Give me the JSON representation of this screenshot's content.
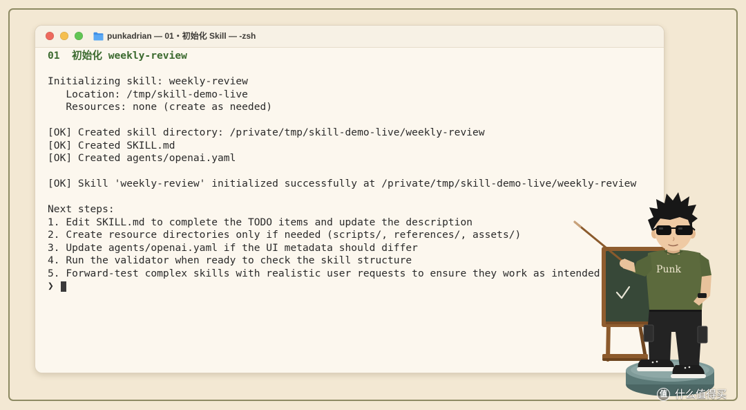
{
  "window": {
    "title": "punkadrian — 01・初始化 Skill — -zsh",
    "title_icon": "folder-icon",
    "traffic_lights": {
      "close": "#ed6a5e",
      "minimize": "#f5bf4f",
      "zoom": "#61c554"
    }
  },
  "terminal": {
    "heading": "01  初始化 weekly-review",
    "init": {
      "line": "Initializing skill: weekly-review",
      "location": "Location: /tmp/skill-demo-live",
      "resources": "Resources: none (create as needed)"
    },
    "created": [
      "[OK] Created skill directory: /private/tmp/skill-demo-live/weekly-review",
      "[OK] Created SKILL.md",
      "[OK] Created agents/openai.yaml"
    ],
    "success": "[OK] Skill 'weekly-review' initialized successfully at /private/tmp/skill-demo-live/weekly-review",
    "next_steps": {
      "title": "Next steps:",
      "items": [
        "1. Edit SKILL.md to complete the TODO items and update the description",
        "2. Create resource directories only if needed (scripts/, references/, assets/)",
        "3. Update agents/openai.yaml if the UI metadata should differ",
        "4. Run the validator when ready to check the skill structure",
        "5. Forward-test complex skills with realistic user requests to ensure they work as intended"
      ]
    },
    "prompt": "❯"
  },
  "illustration": {
    "shirt_text": "Punk",
    "board_icon": "checkmark-icon"
  },
  "watermark": {
    "logo_glyph": "值",
    "text": "什么值得买"
  },
  "colors": {
    "page_background": "#f3e8d3",
    "terminal_background": "#fcf7ee",
    "heading_green": "#3b6a2f",
    "terminal_text": "#2a2a2a",
    "shirt": "#5c6a3d",
    "chalkboard": "#374838"
  }
}
